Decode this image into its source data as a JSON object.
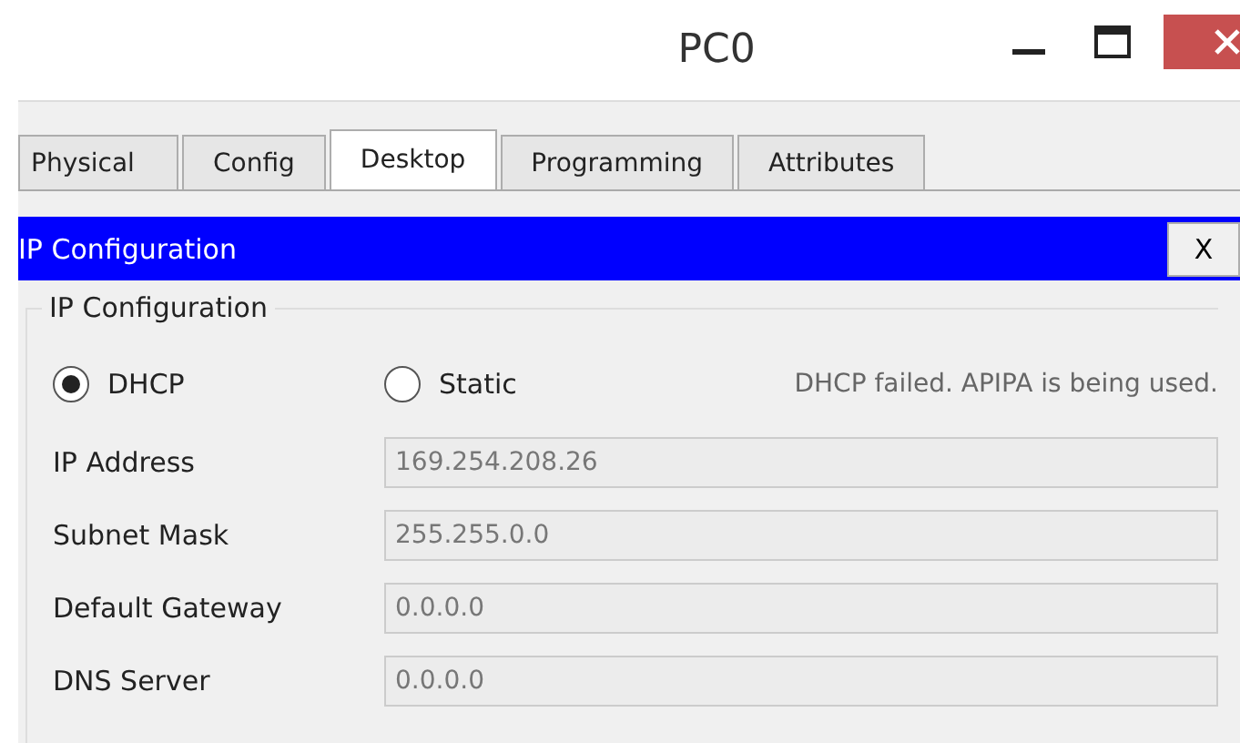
{
  "window": {
    "title": "PC0"
  },
  "tabs": [
    {
      "label": "Physical",
      "selected": false
    },
    {
      "label": "Config",
      "selected": false
    },
    {
      "label": "Desktop",
      "selected": true
    },
    {
      "label": "Programming",
      "selected": false
    },
    {
      "label": "Attributes",
      "selected": false
    }
  ],
  "panel": {
    "title": "IP Configuration",
    "close": "X"
  },
  "group": {
    "title": "IP Configuration",
    "modes": [
      {
        "label": "DHCP",
        "selected": true
      },
      {
        "label": "Static",
        "selected": false
      }
    ],
    "status": "DHCP failed. APIPA is being used.",
    "fields": [
      {
        "label": "IP Address",
        "value": "169.254.208.26"
      },
      {
        "label": "Subnet Mask",
        "value": "255.255.0.0"
      },
      {
        "label": "Default Gateway",
        "value": "0.0.0.0"
      },
      {
        "label": "DNS Server",
        "value": "0.0.0.0"
      }
    ]
  }
}
